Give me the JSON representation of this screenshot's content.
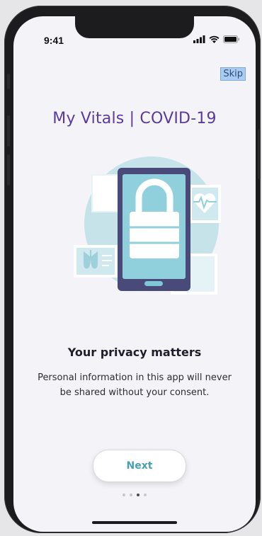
{
  "status_bar": {
    "time": "9:41"
  },
  "skip_label": "Skip",
  "app_title": "My Vitals | COVID-19",
  "headline": "Your privacy matters",
  "body_text": "Personal information in this app will never be shared without your consent.",
  "next_label": "Next",
  "pagination": {
    "total": 4,
    "active_index": 2
  },
  "colors": {
    "title": "#5b3a9b",
    "accent": "#4a9fb3",
    "phone_illustration": "#4a4a7a",
    "screen_illustration": "#8fd0dc",
    "circle": "#c7e3ea"
  },
  "icons": [
    "signal-icon",
    "wifi-icon",
    "battery-icon",
    "lock-icon",
    "heart-pulse-icon",
    "lungs-icon"
  ]
}
